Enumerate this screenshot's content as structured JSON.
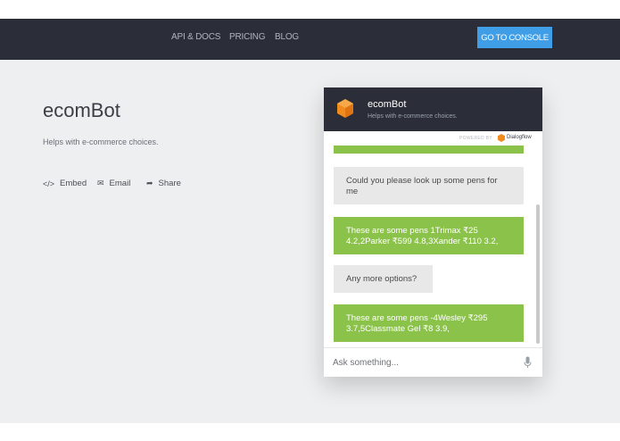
{
  "nav": {
    "links": [
      "API & DOCS",
      "PRICING",
      "BLOG"
    ],
    "console_button": "GO TO CONSOLE"
  },
  "agent": {
    "name": "ecomBot",
    "description": "Helps with e-commerce choices.",
    "actions": [
      {
        "icon": "code-icon",
        "glyph": "</>",
        "label": "Embed"
      },
      {
        "icon": "mail-icon",
        "glyph": "✉",
        "label": "Email"
      },
      {
        "icon": "share-icon",
        "glyph": "➦",
        "label": "Share"
      }
    ]
  },
  "widget": {
    "title": "ecomBot",
    "subtitle": "Helps with e-commerce choices.",
    "powered_by": "POWERED BY",
    "provider": "Dialogflow",
    "messages": [
      {
        "from": "bot",
        "text": ""
      },
      {
        "from": "user",
        "text": "Could you please look up some pens for me"
      },
      {
        "from": "bot",
        "text": "These are some pens 1Trimax ₹25 4.2,2Parker ₹599 4.8,3Xander ₹110 3.2,"
      },
      {
        "from": "user",
        "text": "Any more options?"
      },
      {
        "from": "bot",
        "text": "These are some pens -4Wesley ₹295 3.7,5Classmate Gel ₹8 3.9,"
      }
    ],
    "input_placeholder": "Ask something..."
  },
  "colors": {
    "nav_bg": "#2b2e38",
    "accent_blue": "#3f9ee6",
    "bot_bubble": "#8bc34a",
    "user_bubble": "#e8e8e8",
    "logo_orange": "#f28b1e"
  }
}
